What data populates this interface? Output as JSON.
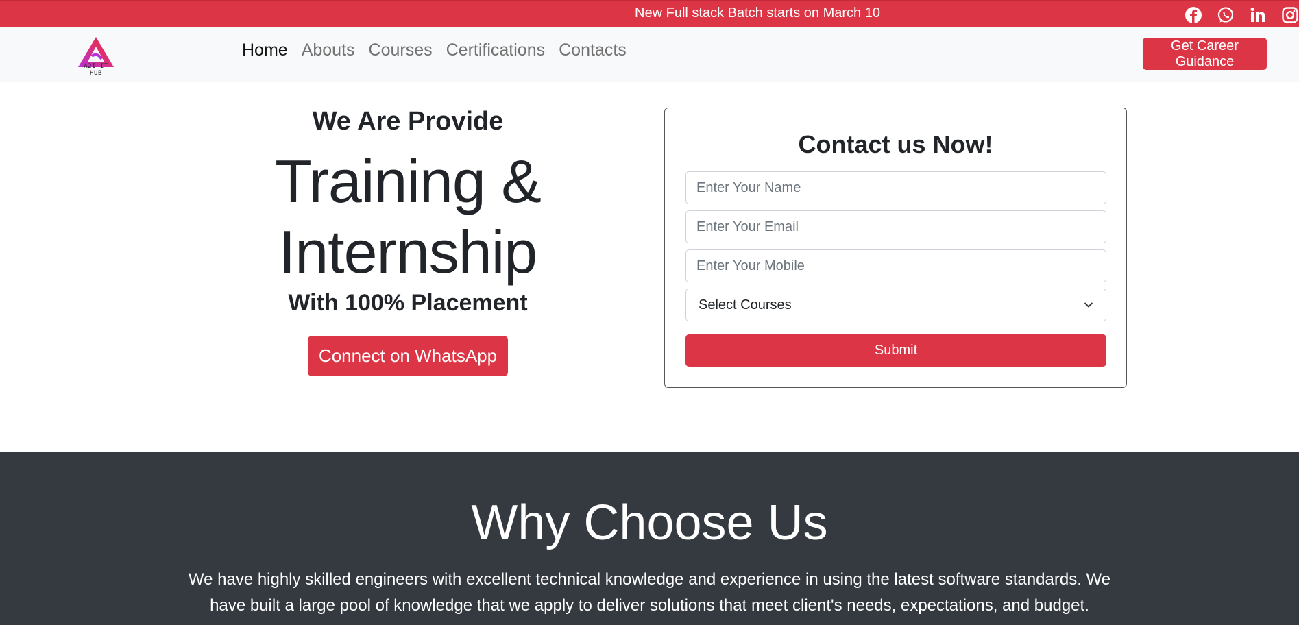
{
  "topbar": {
    "announcement": "New Full stack Batch starts on March 10",
    "social": [
      {
        "icon": "facebook-icon"
      },
      {
        "icon": "whatsapp-icon"
      },
      {
        "icon": "linkedin-icon"
      },
      {
        "icon": "instagram-icon"
      }
    ]
  },
  "navbar": {
    "logo_text": "A2I IT HUB",
    "links": [
      "Home",
      "Abouts",
      "Courses",
      "Certifications",
      "Contacts"
    ],
    "active": "Home",
    "cta_label": "Get Career Guidance"
  },
  "hero": {
    "pre": "We Are Provide",
    "big_line1": "Training &",
    "big_line2": "Internship",
    "sub": "With 100% Placement",
    "whatsapp_label": "Connect on WhatsApp"
  },
  "form": {
    "title": "Contact us Now!",
    "name_placeholder": "Enter Your Name",
    "email_placeholder": "Enter Your Email",
    "mobile_placeholder": "Enter Your Mobile",
    "course_selected": "Select Courses",
    "submit_label": "Submit"
  },
  "why": {
    "title": "Why Choose Us",
    "text": "We have highly skilled engineers with excellent technical knowledge and experience in using the latest software standards. We have built a large pool of knowledge that we apply to deliver solutions that meet client's needs, expectations, and budget."
  },
  "colors": {
    "brand": "#dc3545",
    "dark_section": "#343a40",
    "navbar_bg": "#f8f9fa"
  }
}
